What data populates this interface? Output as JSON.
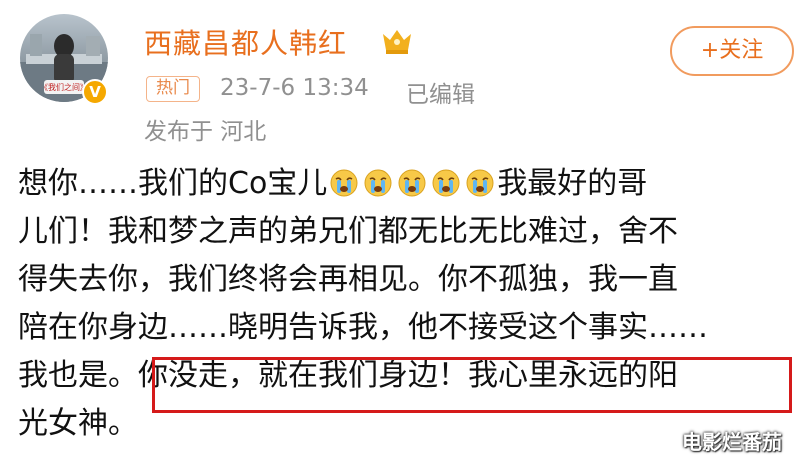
{
  "profile": {
    "username": "西藏昌都人韩红",
    "avatar_badge_text": "《我们之间》",
    "verified_badge": "V"
  },
  "follow_button": {
    "label": "+关注"
  },
  "meta": {
    "hot_tag": "热门",
    "time": "23-7-6 13:34",
    "edited": "已编辑",
    "location": "发布于 河北"
  },
  "post": {
    "line1_a": "想你……我们的Co宝儿",
    "line1_b": "我最好的哥",
    "line2": "儿们！我和梦之声的弟兄们都无比无比难过，舍不",
    "line3": "得失去你，我们终将会再相见。你不孤独，我一直",
    "line4": "陪在你身边……晓明告诉我，他不接受这个事实……",
    "line5": "我也是。你没走，就在我们身边！我心里永远的阳",
    "line6": "光女神。"
  },
  "emoji_name": "crying-face-emoji",
  "emoji_count": 5,
  "watermark": "电影烂番茄",
  "colors": {
    "username": "#e86f1e",
    "meta_gray": "#909090",
    "highlight_box": "#d51a1a"
  }
}
